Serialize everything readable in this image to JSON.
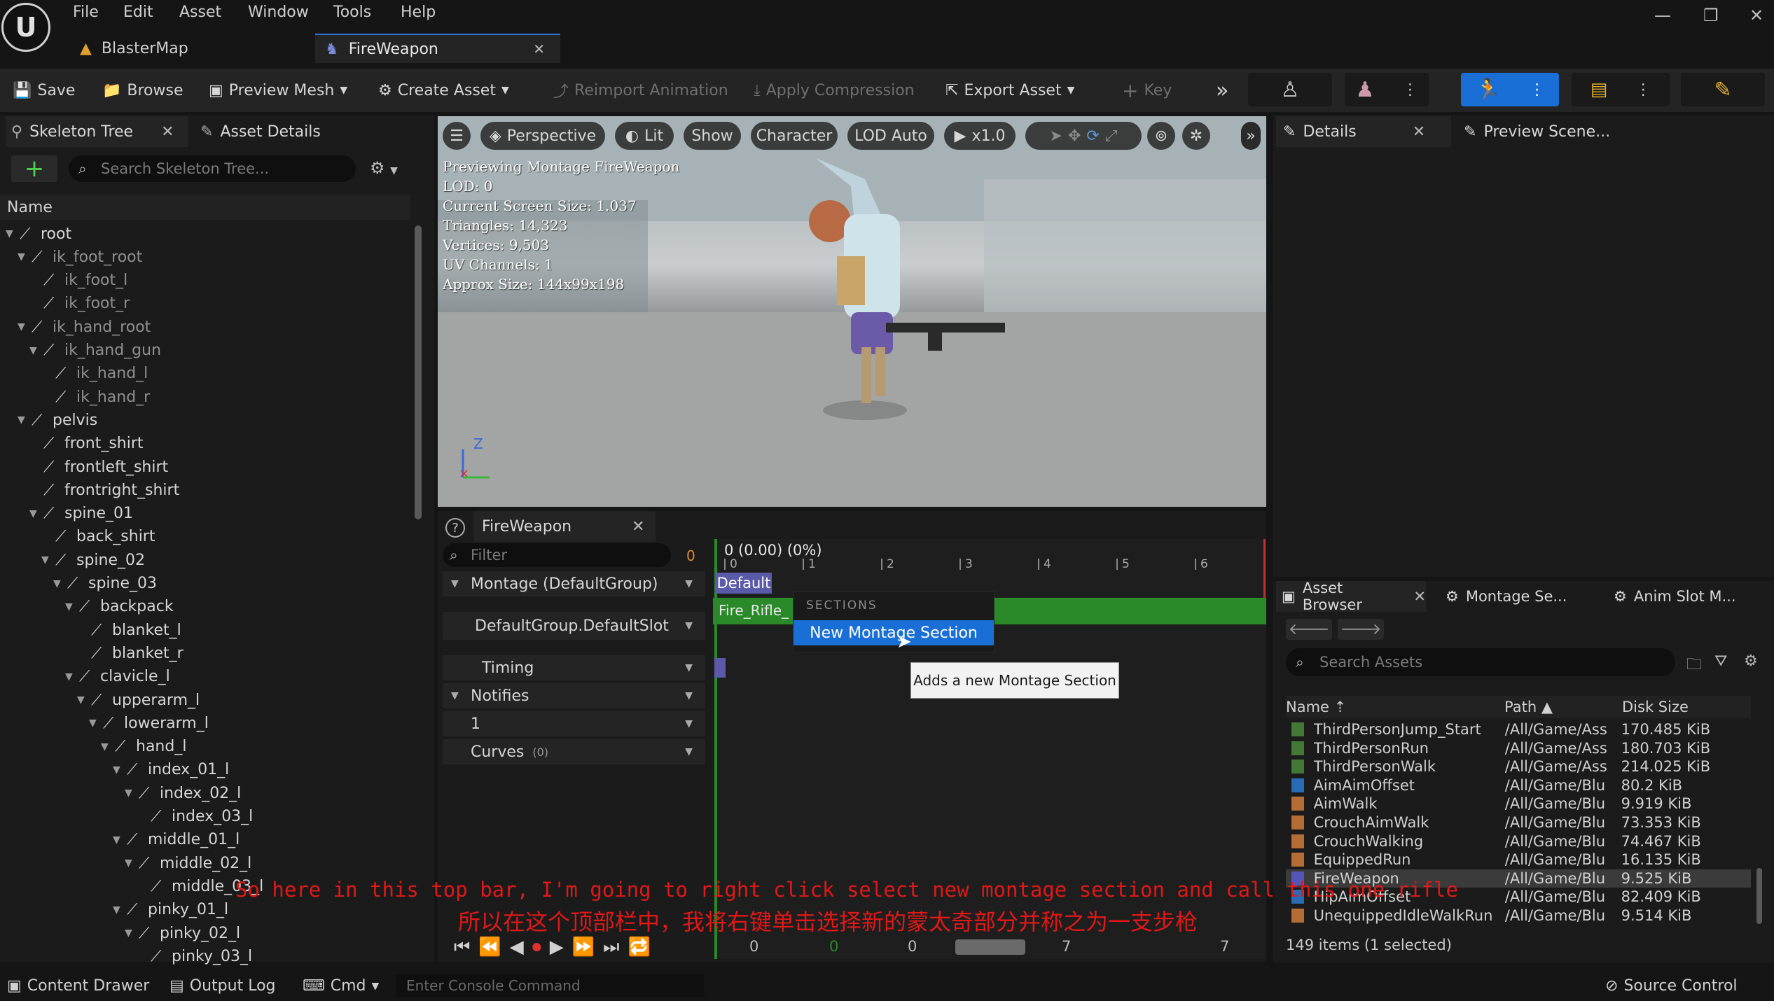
{
  "app": {
    "menu": [
      "File",
      "Edit",
      "Asset",
      "Window",
      "Tools",
      "Help"
    ],
    "tabs": [
      {
        "label": "BlasterMap"
      },
      {
        "label": "FireWeapon"
      }
    ]
  },
  "toolbar": {
    "save": "Save",
    "browse": "Browse",
    "preview_mesh": "Preview Mesh",
    "create_asset": "Create Asset",
    "reimport": "Reimport Animation",
    "apply_compression": "Apply Compression",
    "export_asset": "Export Asset",
    "key": "Key"
  },
  "left_panel": {
    "tab_skeleton": "Skeleton Tree",
    "tab_asset_details": "Asset Details",
    "search_placeholder": "Search Skeleton Tree...",
    "column_name": "Name",
    "bones": [
      {
        "label": "root"
      },
      {
        "label": "ik_foot_root"
      },
      {
        "label": "ik_foot_l"
      },
      {
        "label": "ik_foot_r"
      },
      {
        "label": "ik_hand_root"
      },
      {
        "label": "ik_hand_gun"
      },
      {
        "label": "ik_hand_l"
      },
      {
        "label": "ik_hand_r"
      },
      {
        "label": "pelvis"
      },
      {
        "label": "front_shirt"
      },
      {
        "label": "frontleft_shirt"
      },
      {
        "label": "frontright_shirt"
      },
      {
        "label": "spine_01"
      },
      {
        "label": "back_shirt"
      },
      {
        "label": "spine_02"
      },
      {
        "label": "spine_03"
      },
      {
        "label": "backpack"
      },
      {
        "label": "blanket_l"
      },
      {
        "label": "blanket_r"
      },
      {
        "label": "clavicle_l"
      },
      {
        "label": "upperarm_l"
      },
      {
        "label": "lowerarm_l"
      },
      {
        "label": "hand_l"
      },
      {
        "label": "index_01_l"
      },
      {
        "label": "index_02_l"
      },
      {
        "label": "index_03_l"
      },
      {
        "label": "middle_01_l"
      },
      {
        "label": "middle_02_l"
      },
      {
        "label": "middle_03_l"
      },
      {
        "label": "pinky_01_l"
      },
      {
        "label": "pinky_02_l"
      },
      {
        "label": "pinky_03_l"
      }
    ]
  },
  "viewport": {
    "perspective": "Perspective",
    "lit": "Lit",
    "show": "Show",
    "character": "Character",
    "lod": "LOD Auto",
    "speed": "x1.0",
    "info": [
      "Previewing Montage FireWeapon",
      "LOD: 0",
      "Current Screen Size: 1.037",
      "Triangles: 14,323",
      "Vertices: 9,503",
      "UV Channels: 1",
      "Approx Size: 144x99x198"
    ],
    "axis_z": "Z"
  },
  "details": {
    "tab_details": "Details",
    "tab_preview_scene": "Preview Scene..."
  },
  "montage": {
    "tab": "FireWeapon",
    "filter_placeholder": "Filter",
    "filter_count": "0",
    "time_readout": "0 (0.00) (0%)",
    "ruler": [
      "0",
      "1",
      "2",
      "3",
      "4",
      "5",
      "6"
    ],
    "tracks": {
      "montage_group": "Montage (DefaultGroup)",
      "default_slot": "DefaultGroup.DefaultSlot",
      "timing": "Timing",
      "notifies": "Notifies",
      "notify_track": "1",
      "curves": "Curves",
      "curves_count": "(0)"
    },
    "section_default": "Default",
    "segment": "Fire_Rifle_",
    "context_menu": {
      "header": "SECTIONS",
      "item": "New Montage Section"
    },
    "tooltip": "Adds a new Montage Section",
    "bottom_numbers": [
      "0",
      "0",
      "0",
      "7",
      "7"
    ]
  },
  "asset_browser": {
    "tabs": [
      "Asset Browser",
      "Montage Se...",
      "Anim Slot M..."
    ],
    "search_placeholder": "Search Assets",
    "columns": {
      "name": "Name",
      "path": "Path",
      "size": "Disk Size"
    },
    "rows": [
      {
        "name": "ThirdPersonJump_Start",
        "path": "/All/Game/Ass",
        "size": "170.485 KiB",
        "color": "#4a8a3a"
      },
      {
        "name": "ThirdPersonRun",
        "path": "/All/Game/Ass",
        "size": "180.703 KiB",
        "color": "#4a8a3a"
      },
      {
        "name": "ThirdPersonWalk",
        "path": "/All/Game/Ass",
        "size": "214.025 KiB",
        "color": "#4a8a3a"
      },
      {
        "name": "AimAimOffset",
        "path": "/All/Game/Blu",
        "size": "80.2 KiB",
        "color": "#2a7ad0"
      },
      {
        "name": "AimWalk",
        "path": "/All/Game/Blu",
        "size": "9.919 KiB",
        "color": "#d07a3a"
      },
      {
        "name": "CrouchAimWalk",
        "path": "/All/Game/Blu",
        "size": "73.353 KiB",
        "color": "#d07a3a"
      },
      {
        "name": "CrouchWalking",
        "path": "/All/Game/Blu",
        "size": "74.467 KiB",
        "color": "#d07a3a"
      },
      {
        "name": "EquippedRun",
        "path": "/All/Game/Blu",
        "size": "16.135 KiB",
        "color": "#d07a3a"
      },
      {
        "name": "FireWeapon",
        "path": "/All/Game/Blu",
        "size": "9.525 KiB",
        "color": "#5a5ad0"
      },
      {
        "name": "HipAimOffset",
        "path": "/All/Game/Blu",
        "size": "82.409 KiB",
        "color": "#2a7ad0"
      },
      {
        "name": "UnequippedIdleWalkRun",
        "path": "/All/Game/Blu",
        "size": "9.514 KiB",
        "color": "#d07a3a"
      }
    ],
    "status": "149 items (1 selected)"
  },
  "statusbar": {
    "content_drawer": "Content Drawer",
    "output_log": "Output Log",
    "cmd": "Cmd",
    "console_placeholder": "Enter Console Command",
    "source_control": "Source Control"
  },
  "subtitles": {
    "en": "So here in this top bar, I'm going to right click select new montage section and call this one rifle",
    "zh": "所以在这个顶部栏中，我将右键单击选择新的蒙太奇部分并称之为一支步枪"
  },
  "colors": {
    "accent": "#1a6fd6",
    "section_green": "#2a8a2a",
    "subtitle_red": "#e01818"
  }
}
